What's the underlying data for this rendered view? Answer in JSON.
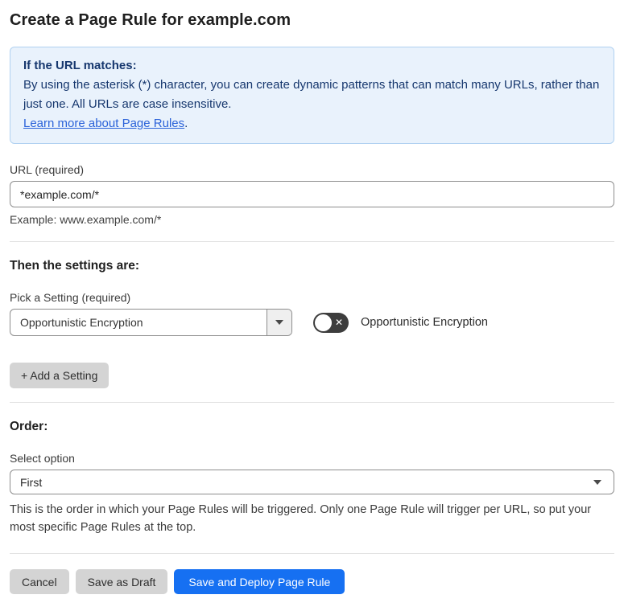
{
  "page": {
    "title": "Create a Page Rule for example.com"
  },
  "info_box": {
    "heading": "If the URL matches:",
    "body": "By using the asterisk (*) character, you can create dynamic patterns that can match many URLs, rather than just one. All URLs are case insensitive.",
    "link_label": "Learn more about Page Rules",
    "link_suffix": "."
  },
  "url_field": {
    "label": "URL (required)",
    "value": "*example.com/*",
    "helper": "Example: www.example.com/*"
  },
  "settings_section": {
    "heading": "Then the settings are:",
    "setting_label": "Pick a Setting (required)",
    "setting_value": "Opportunistic Encryption",
    "toggle_state": "off",
    "toggle_x_glyph": "✕",
    "toggle_label": "Opportunistic Encryption",
    "add_setting_label": "+ Add a Setting"
  },
  "order_section": {
    "heading": "Order:",
    "select_label": "Select option",
    "select_value": "First",
    "helper": "This is the order in which your Page Rules will be triggered. Only one Page Rule will trigger per URL, so put your most specific Page Rules at the top."
  },
  "footer": {
    "cancel_label": "Cancel",
    "save_draft_label": "Save as Draft",
    "save_deploy_label": "Save and Deploy Page Rule"
  },
  "colors": {
    "info_bg": "#e9f2fc",
    "info_border": "#b0d1f1",
    "info_text": "#16376e",
    "link": "#2a62d9",
    "primary_button": "#1670f2",
    "toggle_off_bg": "#3d3d3d",
    "gray_button": "#d4d4d4"
  }
}
